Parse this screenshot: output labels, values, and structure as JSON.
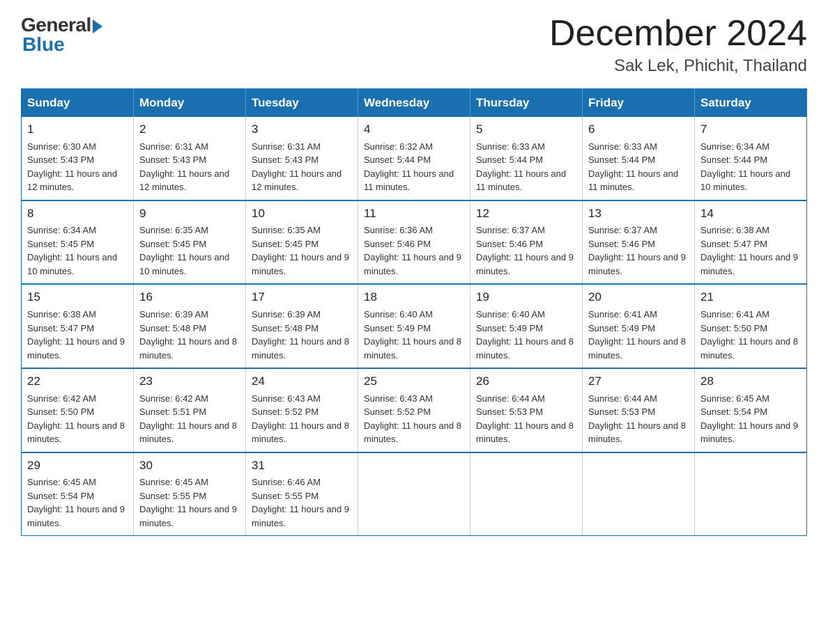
{
  "header": {
    "logo": {
      "general": "General",
      "blue": "Blue"
    },
    "title": "December 2024",
    "subtitle": "Sak Lek, Phichit, Thailand"
  },
  "calendar": {
    "days": [
      "Sunday",
      "Monday",
      "Tuesday",
      "Wednesday",
      "Thursday",
      "Friday",
      "Saturday"
    ],
    "weeks": [
      [
        {
          "num": "1",
          "sunrise": "6:30 AM",
          "sunset": "5:43 PM",
          "daylight": "11 hours and 12 minutes."
        },
        {
          "num": "2",
          "sunrise": "6:31 AM",
          "sunset": "5:43 PM",
          "daylight": "11 hours and 12 minutes."
        },
        {
          "num": "3",
          "sunrise": "6:31 AM",
          "sunset": "5:43 PM",
          "daylight": "11 hours and 12 minutes."
        },
        {
          "num": "4",
          "sunrise": "6:32 AM",
          "sunset": "5:44 PM",
          "daylight": "11 hours and 11 minutes."
        },
        {
          "num": "5",
          "sunrise": "6:33 AM",
          "sunset": "5:44 PM",
          "daylight": "11 hours and 11 minutes."
        },
        {
          "num": "6",
          "sunrise": "6:33 AM",
          "sunset": "5:44 PM",
          "daylight": "11 hours and 11 minutes."
        },
        {
          "num": "7",
          "sunrise": "6:34 AM",
          "sunset": "5:44 PM",
          "daylight": "11 hours and 10 minutes."
        }
      ],
      [
        {
          "num": "8",
          "sunrise": "6:34 AM",
          "sunset": "5:45 PM",
          "daylight": "11 hours and 10 minutes."
        },
        {
          "num": "9",
          "sunrise": "6:35 AM",
          "sunset": "5:45 PM",
          "daylight": "11 hours and 10 minutes."
        },
        {
          "num": "10",
          "sunrise": "6:35 AM",
          "sunset": "5:45 PM",
          "daylight": "11 hours and 9 minutes."
        },
        {
          "num": "11",
          "sunrise": "6:36 AM",
          "sunset": "5:46 PM",
          "daylight": "11 hours and 9 minutes."
        },
        {
          "num": "12",
          "sunrise": "6:37 AM",
          "sunset": "5:46 PM",
          "daylight": "11 hours and 9 minutes."
        },
        {
          "num": "13",
          "sunrise": "6:37 AM",
          "sunset": "5:46 PM",
          "daylight": "11 hours and 9 minutes."
        },
        {
          "num": "14",
          "sunrise": "6:38 AM",
          "sunset": "5:47 PM",
          "daylight": "11 hours and 9 minutes."
        }
      ],
      [
        {
          "num": "15",
          "sunrise": "6:38 AM",
          "sunset": "5:47 PM",
          "daylight": "11 hours and 9 minutes."
        },
        {
          "num": "16",
          "sunrise": "6:39 AM",
          "sunset": "5:48 PM",
          "daylight": "11 hours and 8 minutes."
        },
        {
          "num": "17",
          "sunrise": "6:39 AM",
          "sunset": "5:48 PM",
          "daylight": "11 hours and 8 minutes."
        },
        {
          "num": "18",
          "sunrise": "6:40 AM",
          "sunset": "5:49 PM",
          "daylight": "11 hours and 8 minutes."
        },
        {
          "num": "19",
          "sunrise": "6:40 AM",
          "sunset": "5:49 PM",
          "daylight": "11 hours and 8 minutes."
        },
        {
          "num": "20",
          "sunrise": "6:41 AM",
          "sunset": "5:49 PM",
          "daylight": "11 hours and 8 minutes."
        },
        {
          "num": "21",
          "sunrise": "6:41 AM",
          "sunset": "5:50 PM",
          "daylight": "11 hours and 8 minutes."
        }
      ],
      [
        {
          "num": "22",
          "sunrise": "6:42 AM",
          "sunset": "5:50 PM",
          "daylight": "11 hours and 8 minutes."
        },
        {
          "num": "23",
          "sunrise": "6:42 AM",
          "sunset": "5:51 PM",
          "daylight": "11 hours and 8 minutes."
        },
        {
          "num": "24",
          "sunrise": "6:43 AM",
          "sunset": "5:52 PM",
          "daylight": "11 hours and 8 minutes."
        },
        {
          "num": "25",
          "sunrise": "6:43 AM",
          "sunset": "5:52 PM",
          "daylight": "11 hours and 8 minutes."
        },
        {
          "num": "26",
          "sunrise": "6:44 AM",
          "sunset": "5:53 PM",
          "daylight": "11 hours and 8 minutes."
        },
        {
          "num": "27",
          "sunrise": "6:44 AM",
          "sunset": "5:53 PM",
          "daylight": "11 hours and 8 minutes."
        },
        {
          "num": "28",
          "sunrise": "6:45 AM",
          "sunset": "5:54 PM",
          "daylight": "11 hours and 9 minutes."
        }
      ],
      [
        {
          "num": "29",
          "sunrise": "6:45 AM",
          "sunset": "5:54 PM",
          "daylight": "11 hours and 9 minutes."
        },
        {
          "num": "30",
          "sunrise": "6:45 AM",
          "sunset": "5:55 PM",
          "daylight": "11 hours and 9 minutes."
        },
        {
          "num": "31",
          "sunrise": "6:46 AM",
          "sunset": "5:55 PM",
          "daylight": "11 hours and 9 minutes."
        },
        null,
        null,
        null,
        null
      ]
    ]
  }
}
